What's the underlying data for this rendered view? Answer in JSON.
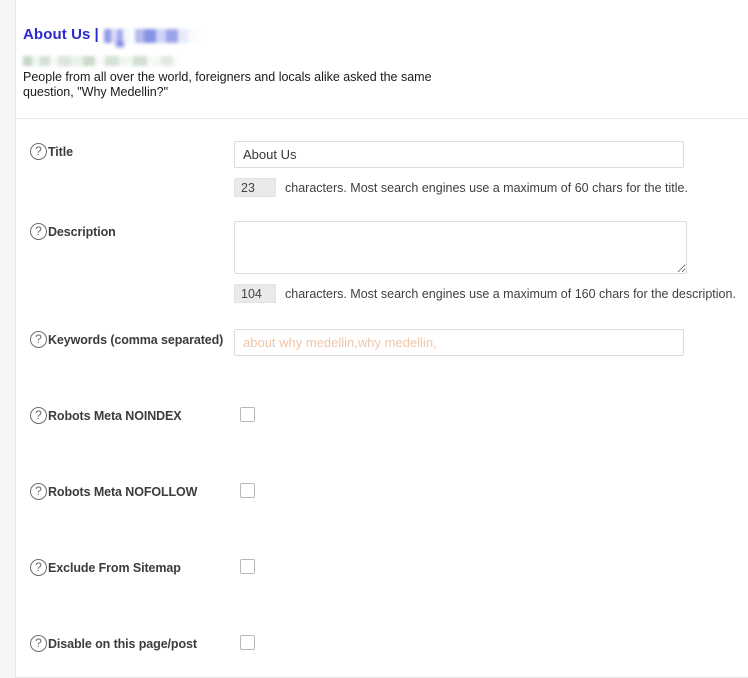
{
  "snippet": {
    "title_text": "About Us",
    "title_separator": "|",
    "title_redacted_label": "redacted-site-name",
    "url_redacted_label": "redacted-url",
    "description": "People from all over the world, foreigners and locals alike asked the same question, \"Why Medellin?\""
  },
  "help_icon": "?",
  "fields": {
    "title": {
      "label": "Title",
      "value": "About Us",
      "placeholder": "",
      "counter": "23",
      "counter_text": "characters. Most search engines use a maximum of 60 chars for the title."
    },
    "description": {
      "label": "Description",
      "value": "",
      "placeholder": "",
      "counter": "104",
      "counter_text": "characters. Most search engines use a maximum of 160 chars for the description."
    },
    "keywords": {
      "label": "Keywords (comma separated)",
      "value": "",
      "placeholder": "about why medellin,why medellin,"
    }
  },
  "checkboxes": [
    {
      "label": "Robots Meta NOINDEX",
      "checked": false
    },
    {
      "label": "Robots Meta NOFOLLOW",
      "checked": false
    },
    {
      "label": "Exclude From Sitemap",
      "checked": false
    },
    {
      "label": "Disable on this page/post",
      "checked": false
    }
  ],
  "colors": {
    "snippet_title": "#2b2bcd",
    "placeholder": "#f0c5a8",
    "panel_border": "#e5e5e5",
    "counter_bg": "#eaeaea"
  }
}
